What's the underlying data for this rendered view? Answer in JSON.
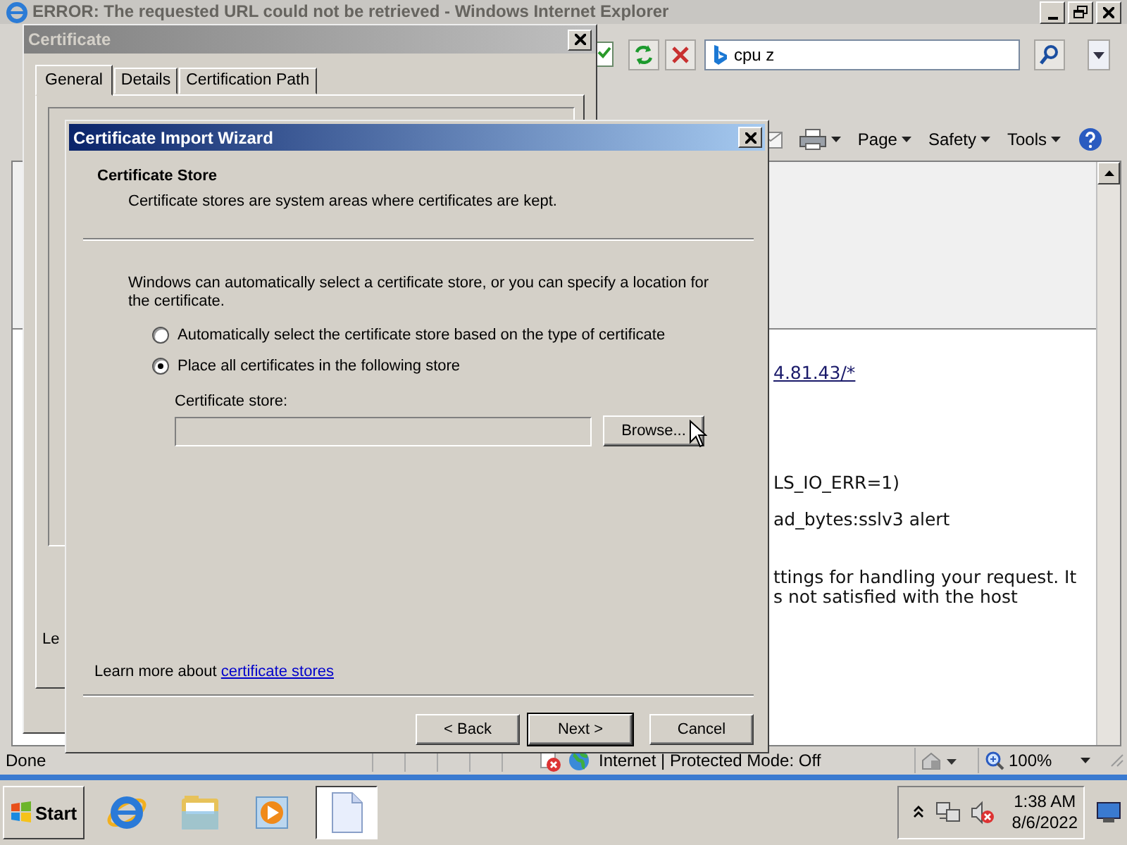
{
  "browser": {
    "title": "ERROR: The requested URL could not be retrieved - Windows Internet Explorer",
    "search": {
      "value": "cpu z"
    },
    "command_bar": [
      "Page",
      "Safety",
      "Tools"
    ],
    "page_fragments": [
      {
        "kind": "link",
        "text": "4.81.43/*"
      },
      {
        "kind": "text",
        "text": "LS_IO_ERR=1)"
      },
      {
        "kind": "text",
        "text": "ad_bytes:sslv3 alert"
      },
      {
        "kind": "text",
        "text": "ttings for handling your request. It"
      },
      {
        "kind": "text",
        "text": "s not satisfied with the host"
      }
    ],
    "status": "Done",
    "zone": "Internet | Protected Mode: Off",
    "zoom": "100%"
  },
  "certificate_dialog": {
    "title": "Certificate",
    "tabs": [
      {
        "label": "General",
        "selected": true
      },
      {
        "label": "Details",
        "selected": false
      },
      {
        "label": "Certification Path",
        "selected": false
      }
    ],
    "fragment": "Le"
  },
  "wizard": {
    "title": "Certificate Import Wizard",
    "heading": "Certificate Store",
    "subheading": "Certificate stores are system areas where certificates are kept.",
    "intro": "Windows can automatically select a certificate store, or you can specify a location for the certificate.",
    "options": [
      {
        "label": "Automatically select the certificate store based on the type of certificate",
        "selected": false
      },
      {
        "label": "Place all certificates in the following store",
        "selected": true
      }
    ],
    "store_label": "Certificate store:",
    "store_field": {
      "disabled": true
    },
    "browse": "Browse...",
    "learn_more": {
      "text": "Learn more about",
      "link": "certificate stores"
    },
    "buttons": [
      {
        "label": "< Back",
        "default": false
      },
      {
        "label": "Next >",
        "default": true
      },
      {
        "label": "Cancel",
        "default": false
      }
    ]
  },
  "taskbar": {
    "start": "Start",
    "apps": [
      {
        "kind": "browser",
        "active": false
      },
      {
        "kind": "folder",
        "active": false
      },
      {
        "kind": "media",
        "active": false
      },
      {
        "kind": "document",
        "active": true
      }
    ],
    "clock": {
      "time": "1:38 AM",
      "date": "8/6/2022"
    }
  }
}
